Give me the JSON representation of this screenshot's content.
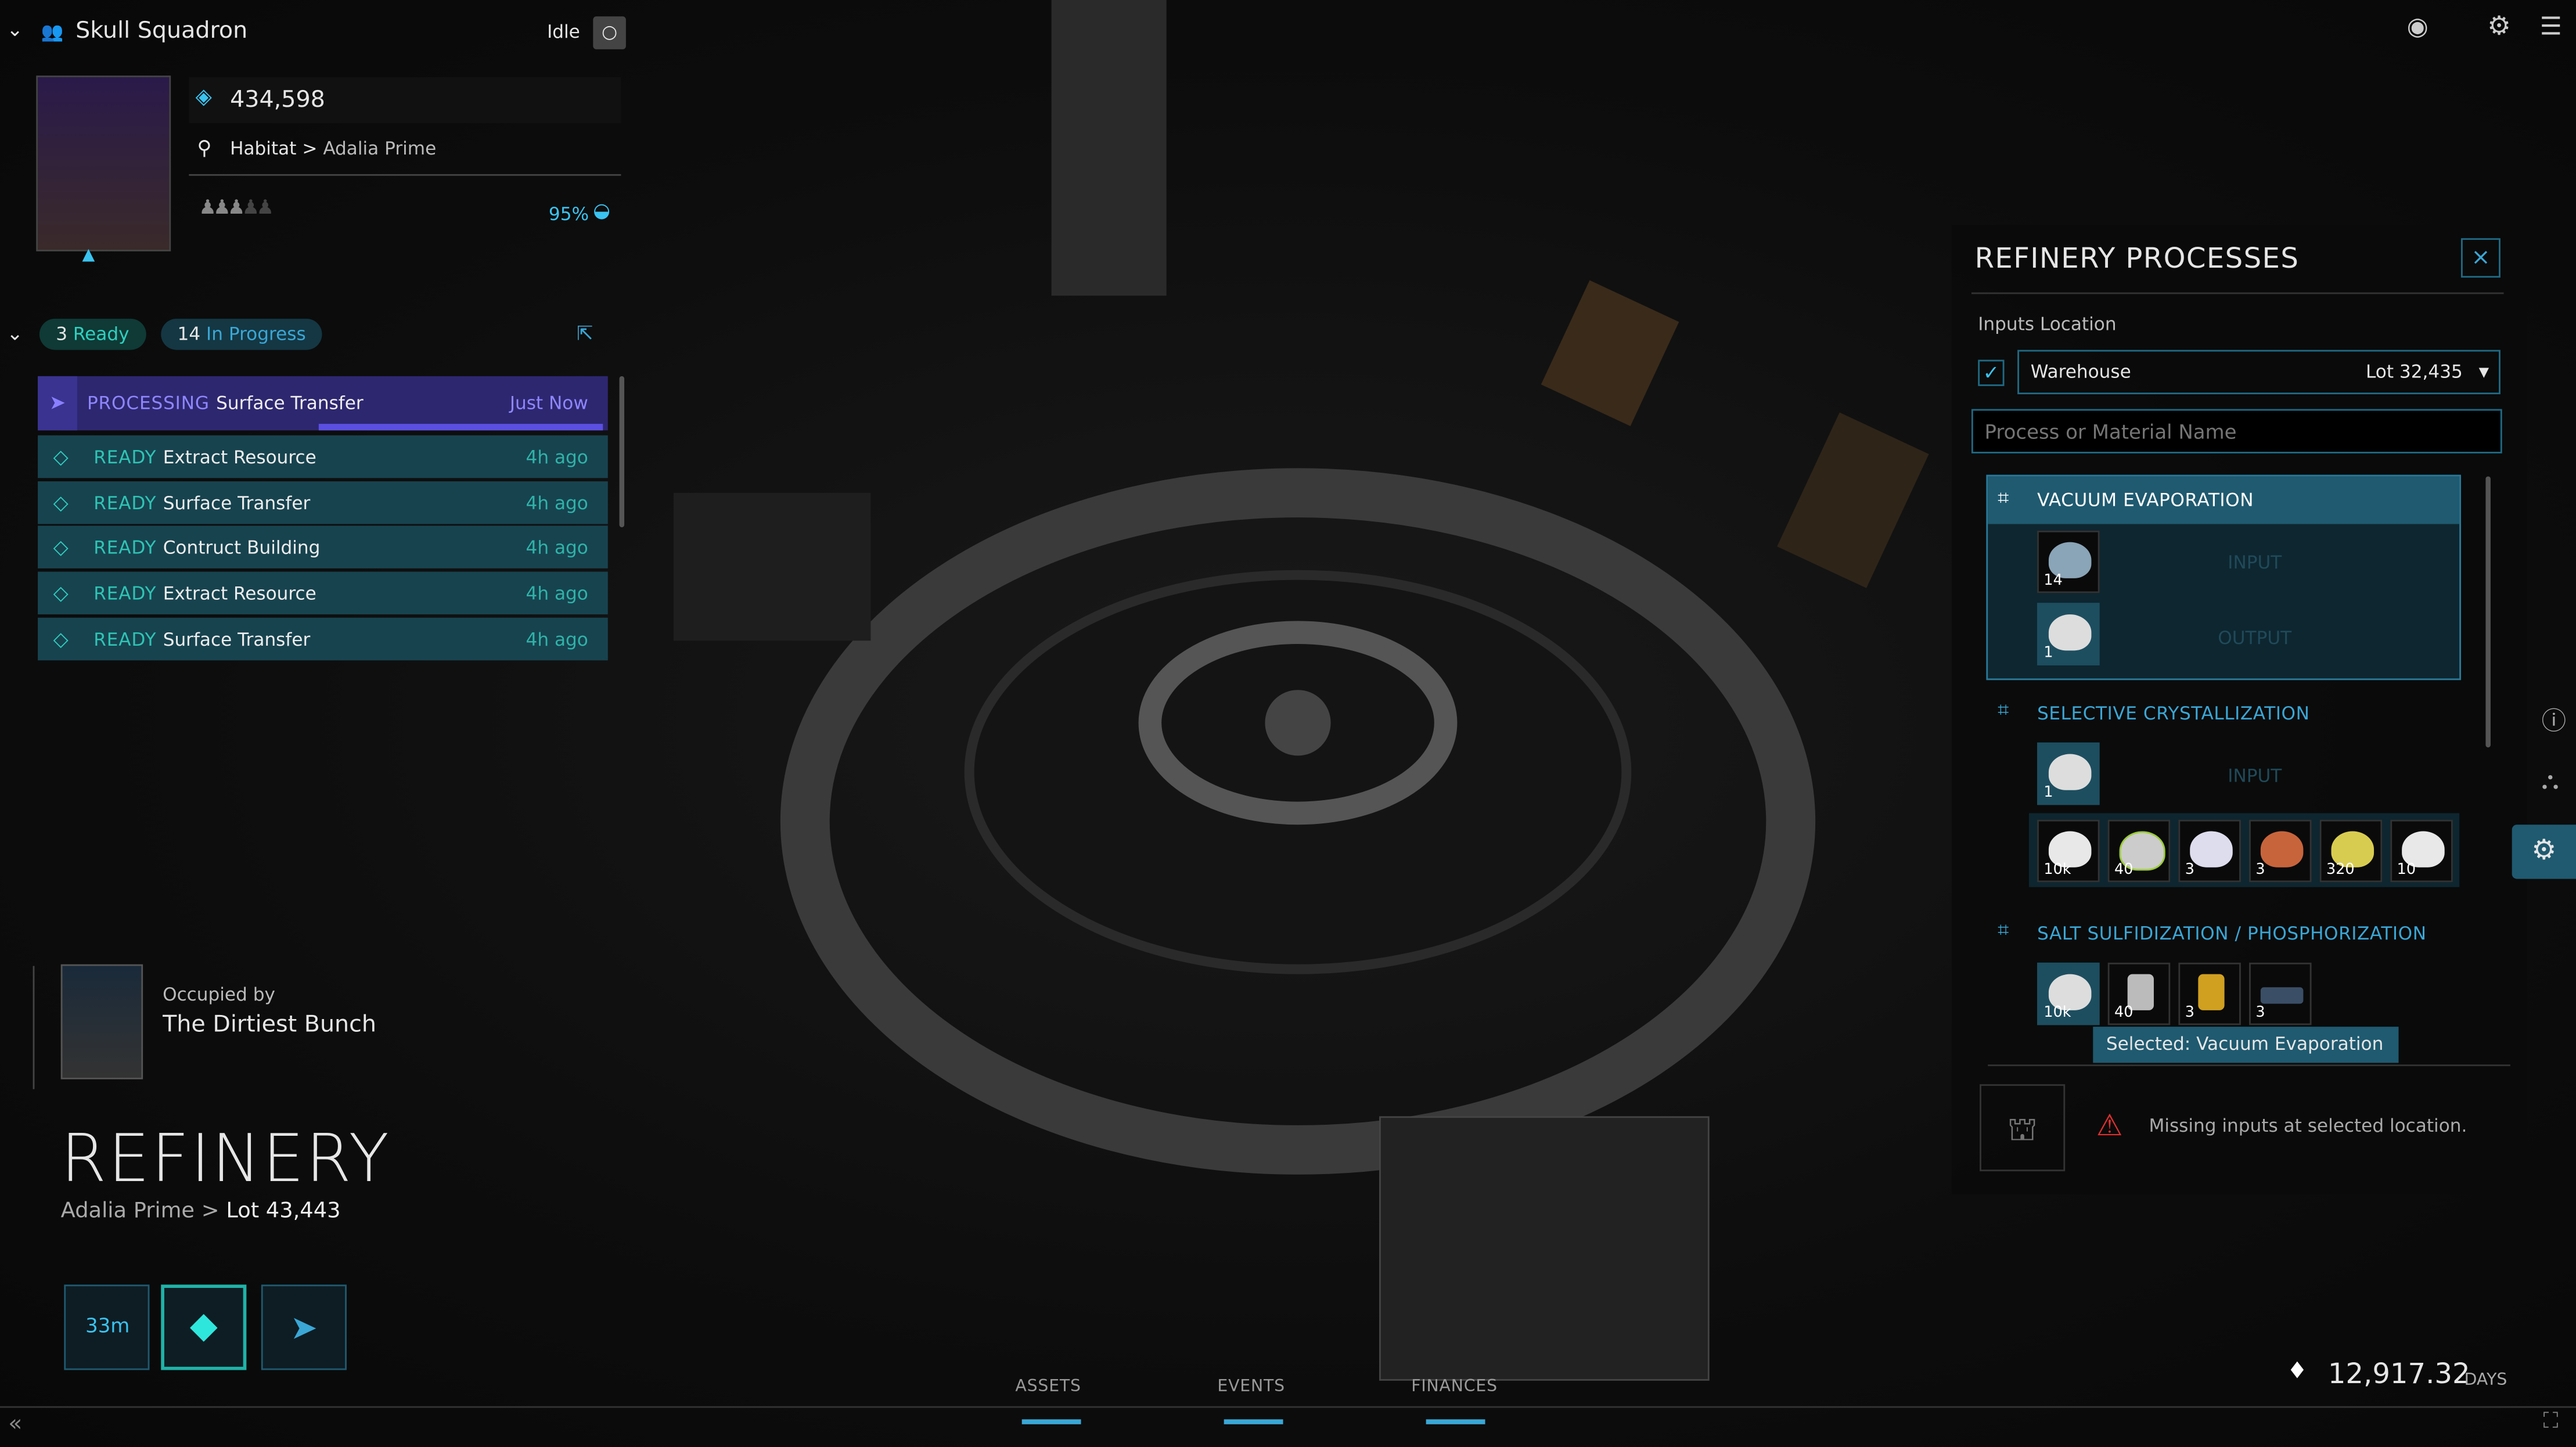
{
  "crew": {
    "name": "Skull Squadron",
    "status": "Idle",
    "balance": "434,598",
    "location_type": "Habitat",
    "location_sep": ">",
    "location_name": "Adalia Prime",
    "food": "95%",
    "crew_count_filled": 3,
    "crew_count_total": 5
  },
  "actions": {
    "ready_count": "3",
    "ready_label": "Ready",
    "progress_count": "14",
    "progress_label": "In Progress",
    "items": [
      {
        "status": "PROCESSING",
        "name": "Surface Transfer",
        "time": "Just Now",
        "progress": 0.5
      },
      {
        "status": "READY",
        "name": "Extract Resource",
        "time": "4h ago"
      },
      {
        "status": "READY",
        "name": "Surface Transfer",
        "time": "4h ago"
      },
      {
        "status": "READY",
        "name": "Contruct Building",
        "time": "4h ago"
      },
      {
        "status": "READY",
        "name": "Extract Resource",
        "time": "4h ago"
      },
      {
        "status": "READY",
        "name": "Surface Transfer",
        "time": "4h ago"
      }
    ]
  },
  "building": {
    "occupied_label": "Occupied by",
    "occupant": "The Dirtiest Bunch",
    "title": "REFINERY",
    "asteroid": "Adalia Prime",
    "sep": ">",
    "lot": "Lot 43,443",
    "timer": "33m"
  },
  "panel": {
    "title": "REFINERY PROCESSES",
    "close": "×",
    "inputs_label": "Inputs Location",
    "location": "Warehouse",
    "lot": "Lot 32,435",
    "search_placeholder": "Process or Material Name",
    "processes": [
      {
        "name": "VACUUM EVAPORATION",
        "input_label": "INPUT",
        "output_label": "OUTPUT",
        "inputs": [
          "14"
        ],
        "outputs": [
          "1"
        ]
      },
      {
        "name": "SELECTIVE CRYSTALLIZATION",
        "input_label": "INPUT",
        "inputs": [
          "1"
        ],
        "outputs": [
          "10k",
          "40",
          "3",
          "3",
          "320",
          "10"
        ]
      },
      {
        "name": "SALT SULFIDIZATION / PHOSPHORIZATION",
        "inputs": [
          "10k",
          "40",
          "3",
          "3"
        ]
      }
    ],
    "tooltip": "Selected: Vacuum Evaporation",
    "warning": "Missing inputs at selected location."
  },
  "footer": {
    "tabs": [
      "ASSETS",
      "EVENTS",
      "FINANCES"
    ],
    "time": "12,917.32",
    "time_unit": "DAYS"
  },
  "colors": {
    "accent": "#3aa7d6",
    "ready": "#2fd0c0",
    "processing": "#5a4fe0",
    "warning": "#e03030"
  }
}
